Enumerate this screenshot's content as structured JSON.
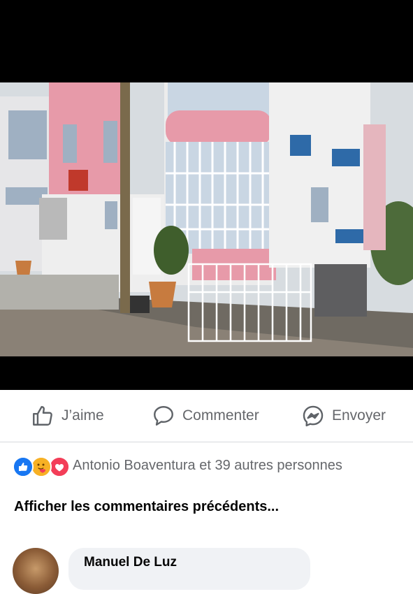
{
  "post": {
    "photo_icon": "building-photo"
  },
  "actions": {
    "like": {
      "label": "J’aime",
      "icon": "thumbs-up-icon"
    },
    "comment": {
      "label": "Commenter",
      "icon": "comment-bubble-icon"
    },
    "send": {
      "label": "Envoyer",
      "icon": "messenger-icon"
    }
  },
  "reactions": {
    "icons": [
      "like-reaction-icon",
      "care-reaction-icon",
      "love-reaction-icon"
    ],
    "summary": "Antonio Boaventura et 39 autres personnes"
  },
  "comments": {
    "view_previous": "Afficher les commentaires précédents...",
    "items": [
      {
        "author": "Manuel De Luz"
      }
    ]
  },
  "colors": {
    "background_top": "#000000",
    "action_text": "#65676b",
    "like_blue": "#1877f2",
    "love_red": "#f33e58",
    "care_yellow": "#f7b125"
  }
}
